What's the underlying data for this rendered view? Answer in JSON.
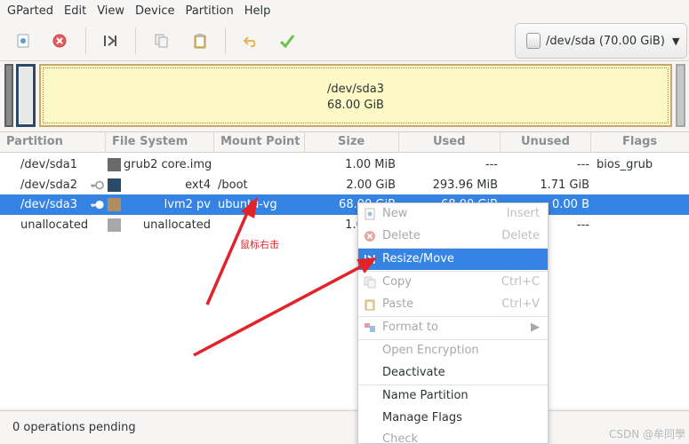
{
  "menubar": [
    "GParted",
    "Edit",
    "View",
    "Device",
    "Partition",
    "Help"
  ],
  "toolbar": {
    "buttons": [
      "new-icon",
      "delete-icon",
      "resize-move-icon",
      "copy-icon",
      "paste-icon",
      "undo-icon",
      "apply-icon"
    ],
    "device": "/dev/sda  (70.00 GiB)"
  },
  "partition_map": {
    "sda3_name": "/dev/sda3",
    "sda3_size": "68.00 GiB"
  },
  "table": {
    "columns": [
      "Partition",
      "File System",
      "Mount Point",
      "Size",
      "Used",
      "Unused",
      "Flags"
    ],
    "rows": [
      {
        "partition": "/dev/sda1",
        "filesystem": "grub2 core.img",
        "mount": "",
        "size": "1.00 MiB",
        "used": "---",
        "unused": "---",
        "flags": "bios_grub",
        "color": "#6a6a6a"
      },
      {
        "partition": "/dev/sda2",
        "filesystem": "ext4",
        "mount": "/boot",
        "size": "2.00 GiB",
        "used": "293.96 MiB",
        "unused": "1.71 GiB",
        "flags": "",
        "color": "#2b4a6a"
      },
      {
        "partition": "/dev/sda3",
        "filesystem": "lvm2 pv",
        "mount": "ubuntu-vg",
        "size": "68.00 GiB",
        "used": "68.00 GiB",
        "unused": "0.00 B",
        "flags": "",
        "color": "#b08c62"
      },
      {
        "partition": "unallocated",
        "filesystem": "unallocated",
        "mount": "",
        "size": "1.00 MiB",
        "used": "---",
        "unused": "---",
        "flags": "",
        "color": "#a8a8a8"
      }
    ]
  },
  "context_menu": {
    "new": "New",
    "new_acc": "Insert",
    "delete": "Delete",
    "delete_acc": "Delete",
    "resize": "Resize/Move",
    "copy": "Copy",
    "copy_acc": "Ctrl+C",
    "paste": "Paste",
    "paste_acc": "Ctrl+V",
    "format": "Format to",
    "open_enc": "Open Encryption",
    "deactivate": "Deactivate",
    "name_partition": "Name Partition",
    "manage_flags": "Manage Flags",
    "check": "Check"
  },
  "annotation": "鼠标右击",
  "status": "0 operations pending",
  "watermark": "CSDN @牟同學"
}
